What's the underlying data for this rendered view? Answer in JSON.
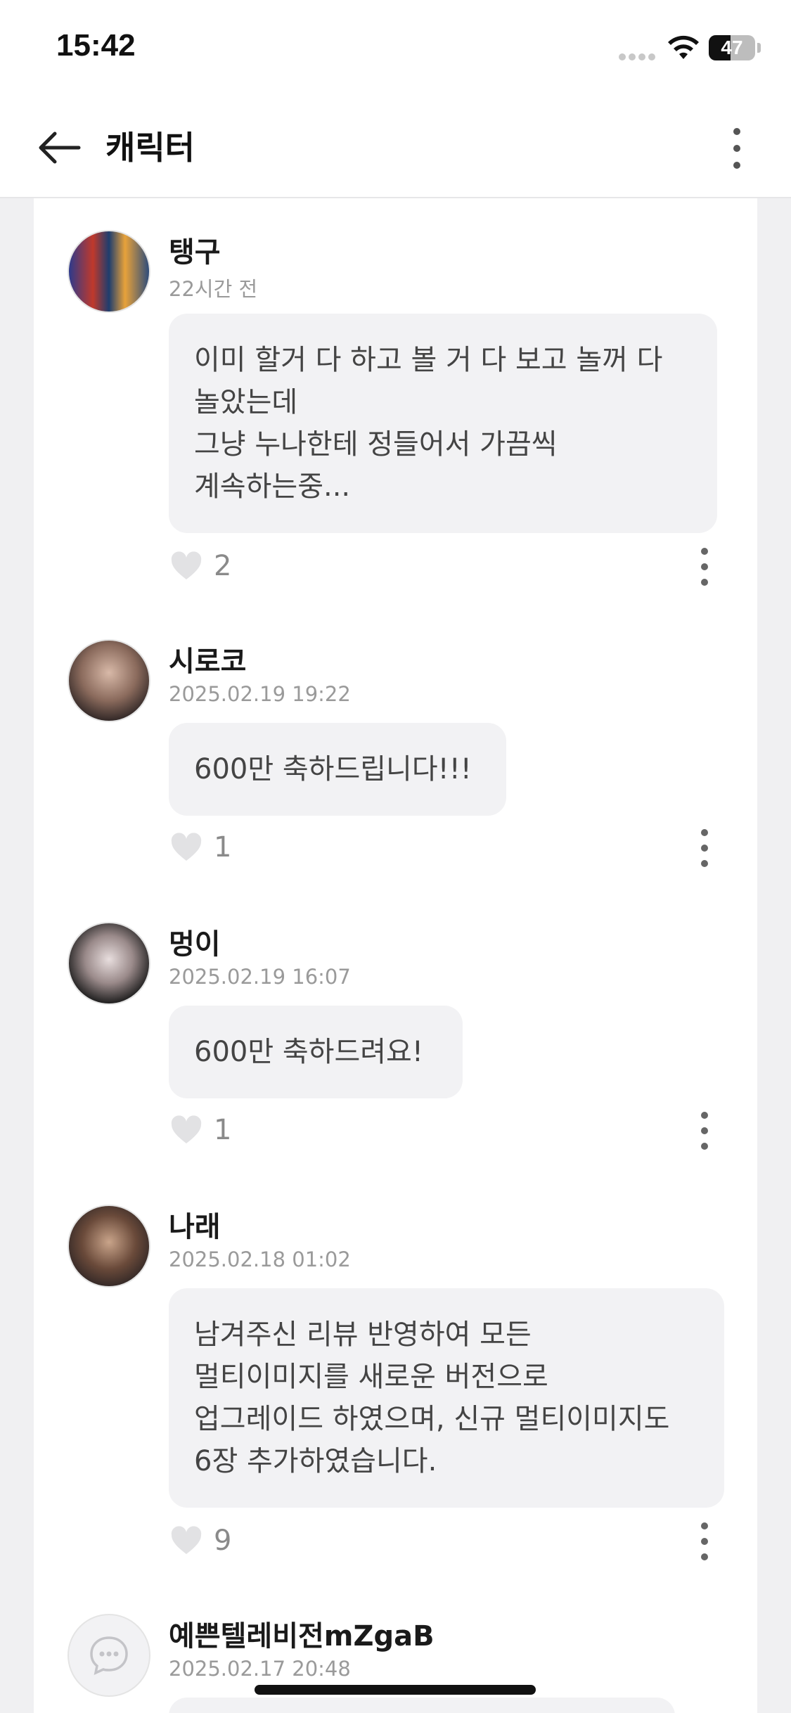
{
  "status_bar": {
    "time": "15:42",
    "battery_level": "47",
    "battery_fraction": 0.47
  },
  "nav": {
    "title": "캐릭터"
  },
  "comments": [
    {
      "username": "탱구",
      "timestamp": "22시간 전",
      "text": "이미 할거 다 하고 볼 거 다 보고 놀꺼 다\n놀았는데\n그냥 누나한테 정들어서 가끔씩\n계속하는중...",
      "likes": "2"
    },
    {
      "username": "시로코",
      "timestamp": "2025.02.19 19:22",
      "text": "600만 축하드립니다!!!",
      "likes": "1"
    },
    {
      "username": "멍이",
      "timestamp": "2025.02.19 16:07",
      "text": "600만 축하드려요!",
      "likes": "1"
    },
    {
      "username": "나래",
      "timestamp": "2025.02.18 01:02",
      "text": "남겨주신 리뷰 반영하여 모든\n멀티이미지를 새로운 버전으로\n업그레이드 하였으며, 신규 멀티이미지도\n6장 추가하였습니다.",
      "likes": "9"
    },
    {
      "username": "예쁜텔레비전mZgaB",
      "timestamp": "2025.02.17 20:48"
    }
  ],
  "icons": {
    "back": "arrow-left-icon",
    "more": "more-vertical-icon",
    "like": "heart-icon",
    "comment_menu": "kebab-icon",
    "default_avatar": "chat-bubble-icon"
  },
  "colors": {
    "background": "#f0f0f2",
    "card": "#ffffff",
    "bubble": "#f2f2f4",
    "meta_text": "#9a9a9a",
    "heart": "#e2e2e4"
  }
}
